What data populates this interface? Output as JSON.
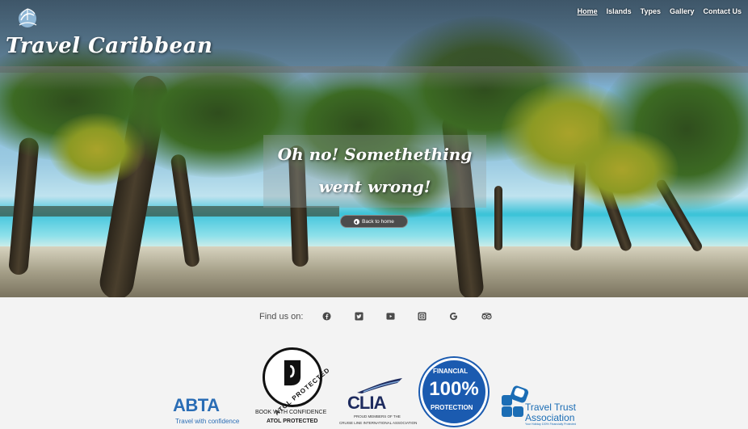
{
  "header": {
    "brand": "Travel Caribbean",
    "nav": [
      "Home",
      "Islands",
      "Types",
      "Gallery",
      "Contact Us"
    ],
    "active_nav": "Home"
  },
  "hero": {
    "message_line1": "Oh no! Somethething",
    "message_line2": "went wrong!",
    "back_button": "Back to home"
  },
  "footer": {
    "find_us": "Find us on:",
    "social_icons": [
      "facebook-icon",
      "twitter-icon",
      "youtube-icon",
      "instagram-icon",
      "google-icon",
      "tripadvisor-icon"
    ],
    "badges": {
      "abta": {
        "name": "ABTA",
        "tagline": "Travel with confidence"
      },
      "atol": {
        "name": "ATOL PROTECTED",
        "line1": "BOOK WITH CONFIDENCE",
        "line2": "ATOL PROTECTED"
      },
      "clia": {
        "name": "CLIA",
        "line1": "PROUD MEMBERS OF THE",
        "line2": "CRUISE LINE INTERNATIONAL ASSOCIATION"
      },
      "financial": {
        "top": "FINANCIAL",
        "pct": "100%",
        "bottom": "PROTECTION"
      },
      "tta": {
        "line1": "Travel Trust",
        "line2": "Association",
        "line3": "Your Holiday 100% Financially Protected"
      }
    }
  },
  "colors": {
    "abta_blue": "#2a6db5",
    "financial_blue": "#1b5bb0",
    "clia_navy": "#1e2b5e",
    "footer_bg": "#f3f3f3"
  }
}
